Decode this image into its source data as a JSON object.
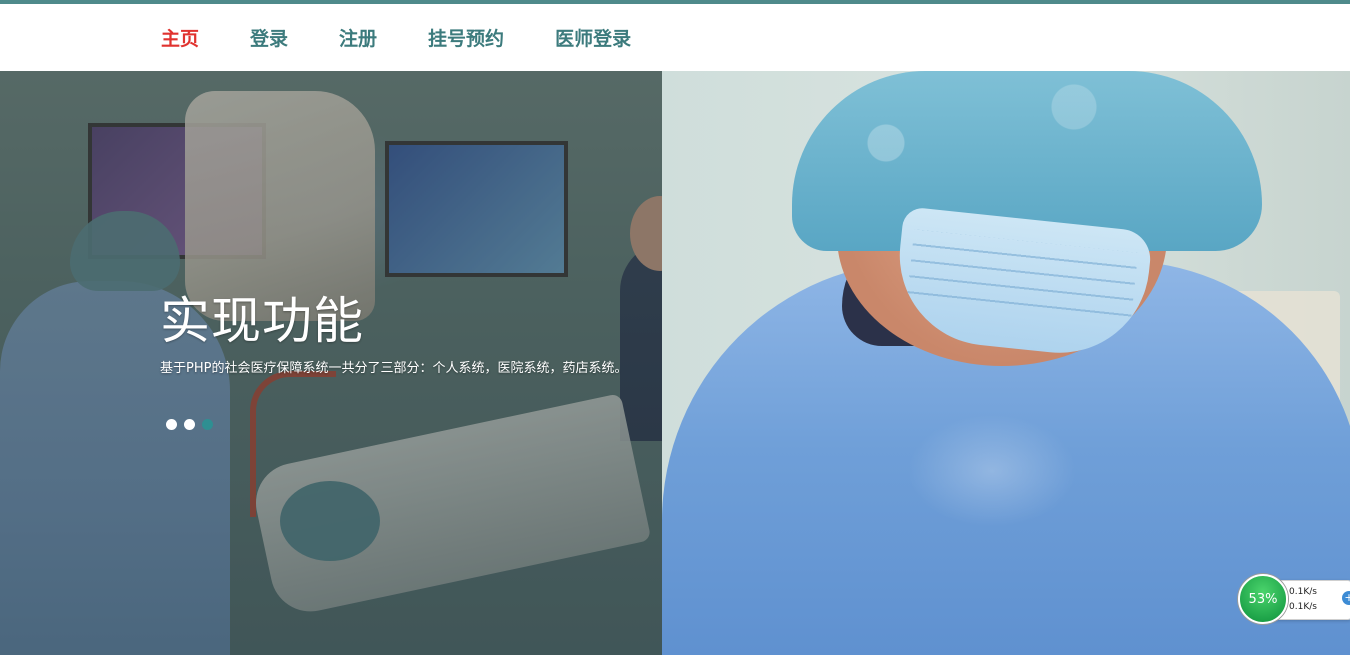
{
  "nav": {
    "items": [
      {
        "label": "主页",
        "active": true
      },
      {
        "label": "登录",
        "active": false
      },
      {
        "label": "注册",
        "active": false
      },
      {
        "label": "挂号预约",
        "active": false
      },
      {
        "label": "医师登录",
        "active": false
      }
    ],
    "accent_color": "#4f8a8b",
    "active_color": "#e0332f"
  },
  "hero": {
    "title": "实现功能",
    "description": "基于PHP的社会医疗保障系统一共分了三部分：个人系统，医院系统，药店系统。",
    "slides": [
      {
        "active": false
      },
      {
        "active": false
      },
      {
        "active": true
      }
    ]
  },
  "net_widget": {
    "percent": "53%",
    "upload": "0.1K/s",
    "download": "0.1K/s"
  }
}
